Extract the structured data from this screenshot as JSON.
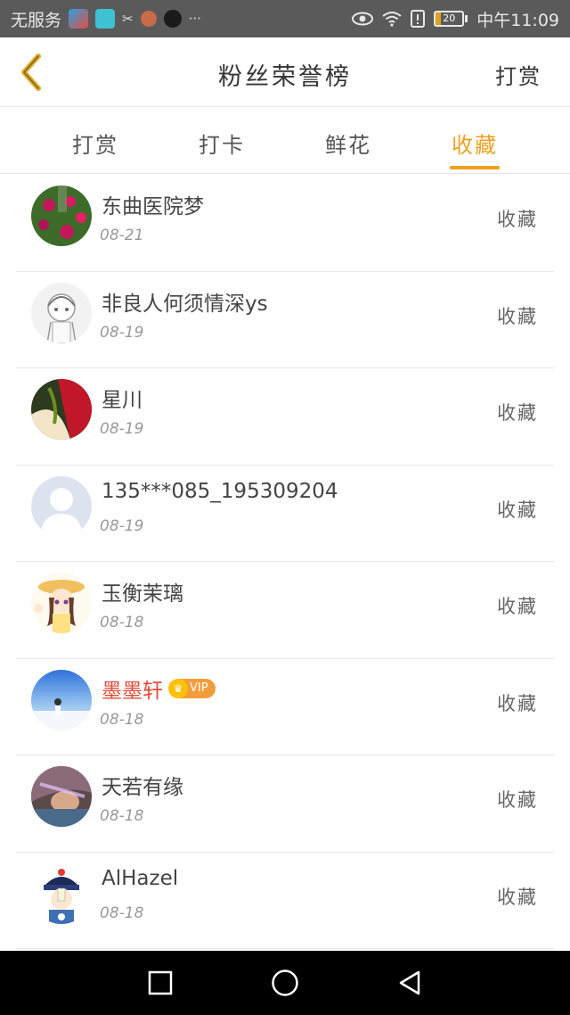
{
  "status_bar": {
    "carrier": "无服务",
    "time": "中午11:09",
    "battery": "20",
    "battery_level": 0.2
  },
  "header": {
    "title": "粉丝荣誉榜",
    "action_label": "打赏"
  },
  "tabs": [
    {
      "label": "打赏",
      "active": false
    },
    {
      "label": "打卡",
      "active": false
    },
    {
      "label": "鲜花",
      "active": false
    },
    {
      "label": "收藏",
      "active": true
    }
  ],
  "list": [
    {
      "name": "东曲医院梦",
      "date": "08-21",
      "action": "收藏",
      "vip": false
    },
    {
      "name": "非良人何须情深ys",
      "date": "08-19",
      "action": "收藏",
      "vip": false
    },
    {
      "name": "星川",
      "date": "08-19",
      "action": "收藏",
      "vip": false
    },
    {
      "name": "135***085_195309204",
      "date": "08-19",
      "action": "收藏",
      "vip": false
    },
    {
      "name": "玉衡茉璃",
      "date": "08-18",
      "action": "收藏",
      "vip": false
    },
    {
      "name": "墨墨轩",
      "date": "08-18",
      "action": "收藏",
      "vip": true,
      "vip_label": "VIP"
    },
    {
      "name": "天若有缘",
      "date": "08-18",
      "action": "收藏",
      "vip": false
    },
    {
      "name": "AlHazel",
      "date": "08-18",
      "action": "收藏",
      "vip": false
    }
  ],
  "colors": {
    "accent": "#f0a020",
    "vip_name": "#e34b3a",
    "status_bar": "#5a5a5a",
    "nav_bar": "#000000"
  },
  "icons": {
    "back": "chevron-left-icon",
    "recent": "square-icon",
    "home": "circle-icon",
    "navback": "triangle-left-icon"
  }
}
